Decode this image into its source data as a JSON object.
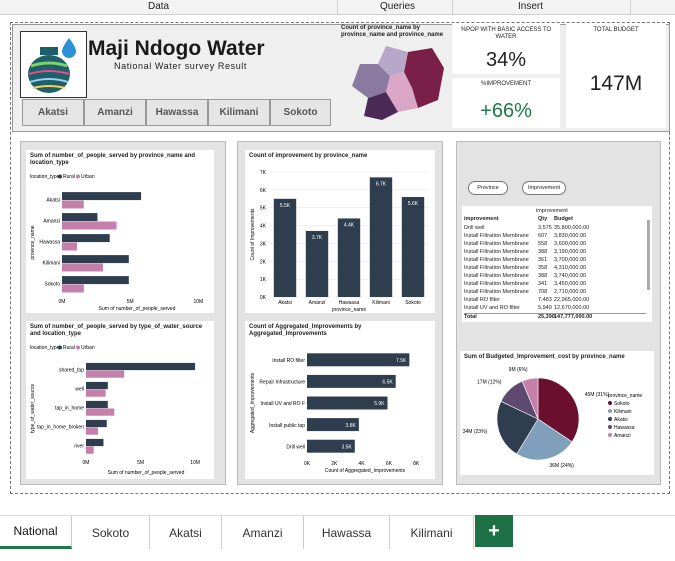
{
  "excel": {
    "menu": [
      "Data",
      "Queries",
      "Insert"
    ],
    "sheet_tabs": [
      "National",
      "Sokoto",
      "Akatsi",
      "Amanzi",
      "Hawassa",
      "Kilimani"
    ],
    "add_sheet": "+"
  },
  "header": {
    "title": "Maji Ndogo Water",
    "subtitle": "National Water survey Result",
    "buttons": [
      "Akatsi",
      "Amanzi",
      "Hawassa",
      "Kilimani",
      "Sokoto"
    ],
    "map_title": "Count of province_name by province_name and province_name"
  },
  "kpis": {
    "basic_access": {
      "label": "%POP WITH BASIC ACCESS TO WATER",
      "value": "34%"
    },
    "improvement": {
      "label": "%IMPROVEMENT",
      "value": "+66%",
      "color": "#1e7a46"
    },
    "budget": {
      "label": "TOTAL BUDGET",
      "value": "147M"
    }
  },
  "colors": {
    "rural": "#2f3e4e",
    "urban": "#c47fab"
  },
  "chart_data": [
    {
      "type": "bar",
      "title": "Sum of number_of_people_served by province_name and location_type",
      "legend_title": "location_type",
      "legend": [
        "Rural",
        "Urban"
      ],
      "categories": [
        "Akatsi",
        "Amanzi",
        "Hawassa",
        "Kilimani",
        "Sokoto"
      ],
      "series": [
        {
          "name": "Rural",
          "values": [
            5.8,
            2.6,
            3.5,
            4.9,
            4.9
          ]
        },
        {
          "name": "Urban",
          "values": [
            1.6,
            4.0,
            1.1,
            3.0,
            1.6
          ]
        }
      ],
      "xlabel": "Sum of number_of_people_served",
      "ylabel": "province_name",
      "xticks": [
        "0M",
        "5M",
        "10M"
      ],
      "xlim": [
        0,
        11
      ]
    },
    {
      "type": "bar",
      "title": "Count of improvement by province_name",
      "categories": [
        "Akatsi",
        "Amanzi",
        "Hawassa",
        "Kilimani",
        "Sokoto"
      ],
      "values": [
        5.5,
        3.7,
        4.4,
        6.7,
        5.6
      ],
      "labels": [
        "5.5K",
        "3.7K",
        "4.4K",
        "6.7K",
        "5.6K"
      ],
      "xlabel": "province_name",
      "ylabel": "Count of Improvements",
      "yticks": [
        "0K",
        "1K",
        "2K",
        "3K",
        "4K",
        "5K",
        "6K",
        "7K"
      ],
      "ylim": [
        0,
        7
      ]
    },
    {
      "type": "bar",
      "title": "Sum of number_of_people_served by type_of_water_source and location_type",
      "legend_title": "location_type",
      "legend": [
        "Rural",
        "Urban"
      ],
      "categories": [
        "shared_tap",
        "well",
        "tap_in_home",
        "tap_in_home_broken",
        "river"
      ],
      "series": [
        {
          "name": "Rural",
          "values": [
            10.0,
            2.0,
            2.0,
            1.9,
            1.6
          ]
        },
        {
          "name": "Urban",
          "values": [
            3.5,
            1.8,
            2.6,
            1.1,
            0.7
          ]
        }
      ],
      "xlabel": "Sum of number_of_people_served",
      "ylabel": "type_of_water_source",
      "xticks": [
        "0M",
        "5M",
        "10M"
      ],
      "xlim": [
        0,
        11
      ]
    },
    {
      "type": "bar",
      "title": "Count of Aggregated_Improvements by Aggregated_Improvements",
      "categories": [
        "Install RO filter",
        "Repair Infrastructure",
        "Install UV and RO F",
        "Install public tap",
        "Drill well"
      ],
      "values": [
        7.5,
        6.5,
        5.9,
        3.8,
        3.5
      ],
      "labels": [
        "7.5K",
        "6.5K",
        "5.9K",
        "3.8K",
        "3.5K"
      ],
      "xlabel": "Count of Aggregated_Improvements",
      "ylabel": "Aggregated_Improvements",
      "xticks": [
        "0K",
        "2K",
        "4K",
        "6K",
        "8K"
      ],
      "xlim": [
        0,
        8.5
      ]
    },
    {
      "type": "pie",
      "title": "Sum of Budgeted_Improvement_cost by province_name",
      "legend_title": "province_name",
      "categories": [
        "Sokoto",
        "Kilimani",
        "Akatsi",
        "Hawassa",
        "Amanzi"
      ],
      "values": [
        34.4,
        24.3,
        23.4,
        11.6,
        6.3
      ],
      "labels": [
        "45M (31%)",
        "36M (24%)",
        "34M (23%)",
        "17M (12%)",
        "9M (6%)"
      ],
      "colors": [
        "#6b0f2e",
        "#7f9fba",
        "#2f3e4e",
        "#5e4a71",
        "#c47fab"
      ]
    }
  ],
  "filters": [
    "Province",
    "Improvement"
  ],
  "table": {
    "header": [
      "improvement",
      "Qty",
      "Budget"
    ],
    "top_label": "improvement",
    "rows": [
      [
        "Drill well",
        "3,575",
        "35,800,000.00"
      ],
      [
        "Install Filtration Membrane",
        "607",
        "3,830,000.00"
      ],
      [
        "Install Filtration Membrane",
        "558",
        "3,600,000.00"
      ],
      [
        "Install Filtration Membrane",
        "388",
        "3,190,000.00"
      ],
      [
        "Install Filtration Membrane",
        "361",
        "3,700,000.00"
      ],
      [
        "Install Filtration Membrane",
        "358",
        "4,310,000.00"
      ],
      [
        "Install Filtration Membrane",
        "388",
        "3,740,000.00"
      ],
      [
        "Install Filtration Membrane",
        "341",
        "3,450,000.00"
      ],
      [
        "Install Filtration Membrane",
        "708",
        "2,710,000.00"
      ],
      [
        "Install RO filter",
        "7,483",
        "22,965,000.00"
      ],
      [
        "Install UV and RO filter",
        "5,949",
        "12,670,000.00"
      ],
      [
        "Total",
        "25,390",
        "147,777,000.00"
      ]
    ]
  }
}
